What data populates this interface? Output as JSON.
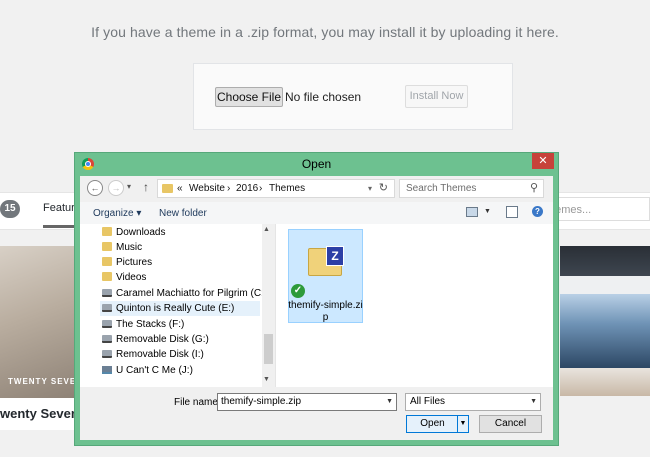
{
  "page": {
    "upload_message": "If you have a theme in a .zip format, you may install it by uploading it here.",
    "choose_file_label": "Choose File",
    "no_file_text": "No file chosen",
    "install_label": "Install Now",
    "theme_count": "15",
    "featured_tab": "Feature",
    "search_placeholder": "hemes...",
    "theme_caption": "TWENTY SEVEN",
    "theme_name": "wenty Seventee"
  },
  "dialog": {
    "title": "Open",
    "close_glyph": "✕",
    "breadcrumb": [
      "«",
      "Website",
      "›",
      "2016",
      "›",
      "Themes"
    ],
    "search_placeholder": "Search Themes",
    "organize_label": "Organize ▾",
    "new_folder_label": "New folder",
    "nav_items": [
      {
        "label": "Downloads",
        "icon": "folder"
      },
      {
        "label": "Music",
        "icon": "folder"
      },
      {
        "label": "Pictures",
        "icon": "folder"
      },
      {
        "label": "Videos",
        "icon": "folder"
      },
      {
        "label": "Caramel Machiatto for Pilgrim (C:)",
        "icon": "drive"
      },
      {
        "label": "Quinton is Really Cute (E:)",
        "icon": "drive"
      },
      {
        "label": "The Stacks (F:)",
        "icon": "drive"
      },
      {
        "label": "Removable Disk (G:)",
        "icon": "drive"
      },
      {
        "label": "Removable Disk (I:)",
        "icon": "drive"
      },
      {
        "label": "U Can't C Me (J:)",
        "icon": "net"
      }
    ],
    "selected_file": "themify-simple.zip",
    "file_name_label": "File name:",
    "file_name_value": "themify-simple.zip",
    "file_type_value": "All Files",
    "open_label": "Open",
    "cancel_label": "Cancel"
  }
}
